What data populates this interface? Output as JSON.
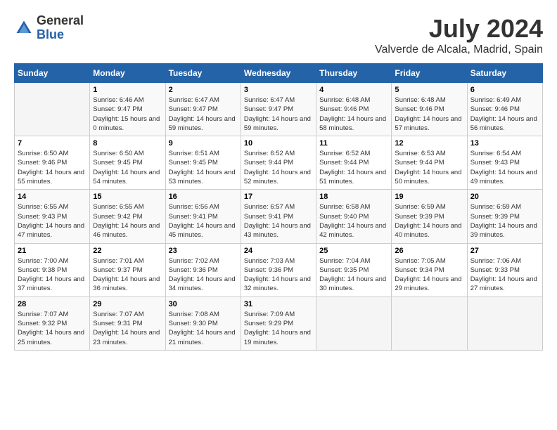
{
  "logo": {
    "general": "General",
    "blue": "Blue"
  },
  "title": {
    "month": "July 2024",
    "location": "Valverde de Alcala, Madrid, Spain"
  },
  "headers": [
    "Sunday",
    "Monday",
    "Tuesday",
    "Wednesday",
    "Thursday",
    "Friday",
    "Saturday"
  ],
  "weeks": [
    [
      {
        "day": "",
        "sunrise": "",
        "sunset": "",
        "daylight": "",
        "empty": true
      },
      {
        "day": "1",
        "sunrise": "Sunrise: 6:46 AM",
        "sunset": "Sunset: 9:47 PM",
        "daylight": "Daylight: 15 hours and 0 minutes."
      },
      {
        "day": "2",
        "sunrise": "Sunrise: 6:47 AM",
        "sunset": "Sunset: 9:47 PM",
        "daylight": "Daylight: 14 hours and 59 minutes."
      },
      {
        "day": "3",
        "sunrise": "Sunrise: 6:47 AM",
        "sunset": "Sunset: 9:47 PM",
        "daylight": "Daylight: 14 hours and 59 minutes."
      },
      {
        "day": "4",
        "sunrise": "Sunrise: 6:48 AM",
        "sunset": "Sunset: 9:46 PM",
        "daylight": "Daylight: 14 hours and 58 minutes."
      },
      {
        "day": "5",
        "sunrise": "Sunrise: 6:48 AM",
        "sunset": "Sunset: 9:46 PM",
        "daylight": "Daylight: 14 hours and 57 minutes."
      },
      {
        "day": "6",
        "sunrise": "Sunrise: 6:49 AM",
        "sunset": "Sunset: 9:46 PM",
        "daylight": "Daylight: 14 hours and 56 minutes."
      }
    ],
    [
      {
        "day": "7",
        "sunrise": "Sunrise: 6:50 AM",
        "sunset": "Sunset: 9:46 PM",
        "daylight": "Daylight: 14 hours and 55 minutes."
      },
      {
        "day": "8",
        "sunrise": "Sunrise: 6:50 AM",
        "sunset": "Sunset: 9:45 PM",
        "daylight": "Daylight: 14 hours and 54 minutes."
      },
      {
        "day": "9",
        "sunrise": "Sunrise: 6:51 AM",
        "sunset": "Sunset: 9:45 PM",
        "daylight": "Daylight: 14 hours and 53 minutes."
      },
      {
        "day": "10",
        "sunrise": "Sunrise: 6:52 AM",
        "sunset": "Sunset: 9:44 PM",
        "daylight": "Daylight: 14 hours and 52 minutes."
      },
      {
        "day": "11",
        "sunrise": "Sunrise: 6:52 AM",
        "sunset": "Sunset: 9:44 PM",
        "daylight": "Daylight: 14 hours and 51 minutes."
      },
      {
        "day": "12",
        "sunrise": "Sunrise: 6:53 AM",
        "sunset": "Sunset: 9:44 PM",
        "daylight": "Daylight: 14 hours and 50 minutes."
      },
      {
        "day": "13",
        "sunrise": "Sunrise: 6:54 AM",
        "sunset": "Sunset: 9:43 PM",
        "daylight": "Daylight: 14 hours and 49 minutes."
      }
    ],
    [
      {
        "day": "14",
        "sunrise": "Sunrise: 6:55 AM",
        "sunset": "Sunset: 9:43 PM",
        "daylight": "Daylight: 14 hours and 47 minutes."
      },
      {
        "day": "15",
        "sunrise": "Sunrise: 6:55 AM",
        "sunset": "Sunset: 9:42 PM",
        "daylight": "Daylight: 14 hours and 46 minutes."
      },
      {
        "day": "16",
        "sunrise": "Sunrise: 6:56 AM",
        "sunset": "Sunset: 9:41 PM",
        "daylight": "Daylight: 14 hours and 45 minutes."
      },
      {
        "day": "17",
        "sunrise": "Sunrise: 6:57 AM",
        "sunset": "Sunset: 9:41 PM",
        "daylight": "Daylight: 14 hours and 43 minutes."
      },
      {
        "day": "18",
        "sunrise": "Sunrise: 6:58 AM",
        "sunset": "Sunset: 9:40 PM",
        "daylight": "Daylight: 14 hours and 42 minutes."
      },
      {
        "day": "19",
        "sunrise": "Sunrise: 6:59 AM",
        "sunset": "Sunset: 9:39 PM",
        "daylight": "Daylight: 14 hours and 40 minutes."
      },
      {
        "day": "20",
        "sunrise": "Sunrise: 6:59 AM",
        "sunset": "Sunset: 9:39 PM",
        "daylight": "Daylight: 14 hours and 39 minutes."
      }
    ],
    [
      {
        "day": "21",
        "sunrise": "Sunrise: 7:00 AM",
        "sunset": "Sunset: 9:38 PM",
        "daylight": "Daylight: 14 hours and 37 minutes."
      },
      {
        "day": "22",
        "sunrise": "Sunrise: 7:01 AM",
        "sunset": "Sunset: 9:37 PM",
        "daylight": "Daylight: 14 hours and 36 minutes."
      },
      {
        "day": "23",
        "sunrise": "Sunrise: 7:02 AM",
        "sunset": "Sunset: 9:36 PM",
        "daylight": "Daylight: 14 hours and 34 minutes."
      },
      {
        "day": "24",
        "sunrise": "Sunrise: 7:03 AM",
        "sunset": "Sunset: 9:36 PM",
        "daylight": "Daylight: 14 hours and 32 minutes."
      },
      {
        "day": "25",
        "sunrise": "Sunrise: 7:04 AM",
        "sunset": "Sunset: 9:35 PM",
        "daylight": "Daylight: 14 hours and 30 minutes."
      },
      {
        "day": "26",
        "sunrise": "Sunrise: 7:05 AM",
        "sunset": "Sunset: 9:34 PM",
        "daylight": "Daylight: 14 hours and 29 minutes."
      },
      {
        "day": "27",
        "sunrise": "Sunrise: 7:06 AM",
        "sunset": "Sunset: 9:33 PM",
        "daylight": "Daylight: 14 hours and 27 minutes."
      }
    ],
    [
      {
        "day": "28",
        "sunrise": "Sunrise: 7:07 AM",
        "sunset": "Sunset: 9:32 PM",
        "daylight": "Daylight: 14 hours and 25 minutes."
      },
      {
        "day": "29",
        "sunrise": "Sunrise: 7:07 AM",
        "sunset": "Sunset: 9:31 PM",
        "daylight": "Daylight: 14 hours and 23 minutes."
      },
      {
        "day": "30",
        "sunrise": "Sunrise: 7:08 AM",
        "sunset": "Sunset: 9:30 PM",
        "daylight": "Daylight: 14 hours and 21 minutes."
      },
      {
        "day": "31",
        "sunrise": "Sunrise: 7:09 AM",
        "sunset": "Sunset: 9:29 PM",
        "daylight": "Daylight: 14 hours and 19 minutes."
      },
      {
        "day": "",
        "sunrise": "",
        "sunset": "",
        "daylight": "",
        "empty": true
      },
      {
        "day": "",
        "sunrise": "",
        "sunset": "",
        "daylight": "",
        "empty": true
      },
      {
        "day": "",
        "sunrise": "",
        "sunset": "",
        "daylight": "",
        "empty": true
      }
    ]
  ]
}
